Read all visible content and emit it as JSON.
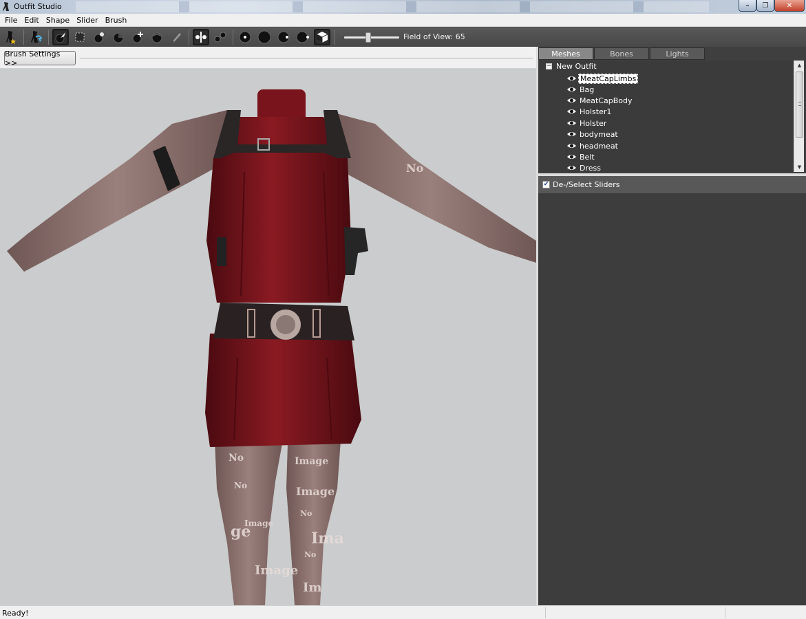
{
  "window": {
    "title": "Outfit Studio",
    "buttons": {
      "minimize": "–",
      "maximize": "❐",
      "close": "✕"
    }
  },
  "menu": [
    "File",
    "Edit",
    "Shape",
    "Slider",
    "Brush"
  ],
  "toolbar": {
    "icons": [
      "new-project-icon",
      "load-project-icon",
      "select-brush-icon",
      "mask-brush-icon",
      "inflate-brush-icon",
      "deflate-brush-icon",
      "move-brush-icon",
      "smooth-brush-icon",
      "weight-brush-icon",
      "x-mirror-icon",
      "connected-only-icon",
      "vertex-dot-icon",
      "point-large-icon",
      "point-medium-icon",
      "point-small-icon",
      "cube-view-icon"
    ],
    "fov_label": "Field of View: 65",
    "fov_value": 65
  },
  "brush_settings_label": "Brush Settings >>",
  "viewport": {
    "model_overlay_texts": [
      "No",
      "Image",
      "No",
      "Image",
      "No",
      "Image",
      "Ima",
      "No",
      "ge",
      "Image",
      "No",
      "Im"
    ]
  },
  "tabs": [
    {
      "label": "Meshes",
      "active": true
    },
    {
      "label": "Bones",
      "active": false
    },
    {
      "label": "Lights",
      "active": false
    }
  ],
  "tree": {
    "root_label": "New Outfit",
    "expander": "−",
    "items": [
      {
        "label": "MeatCapLimbs",
        "selected": true
      },
      {
        "label": "Bag",
        "selected": false
      },
      {
        "label": "MeatCapBody",
        "selected": false
      },
      {
        "label": "Holster1",
        "selected": false
      },
      {
        "label": "Holster",
        "selected": false
      },
      {
        "label": "bodymeat",
        "selected": false
      },
      {
        "label": "headmeat",
        "selected": false
      },
      {
        "label": "Belt",
        "selected": false
      },
      {
        "label": "Dress",
        "selected": false
      }
    ],
    "scroll_up": "▲",
    "scroll_down": "▼"
  },
  "sliders": {
    "header_label": "De-/Select Sliders",
    "checked": true,
    "check_mark": "✔"
  },
  "status": {
    "text": "Ready!"
  },
  "colors": {
    "toolbar_bg": "#505050",
    "panel_bg": "#3f3f3f",
    "viewport_bg": "#cacccd",
    "dress": "#6e1219",
    "skin": "#8d7370"
  }
}
